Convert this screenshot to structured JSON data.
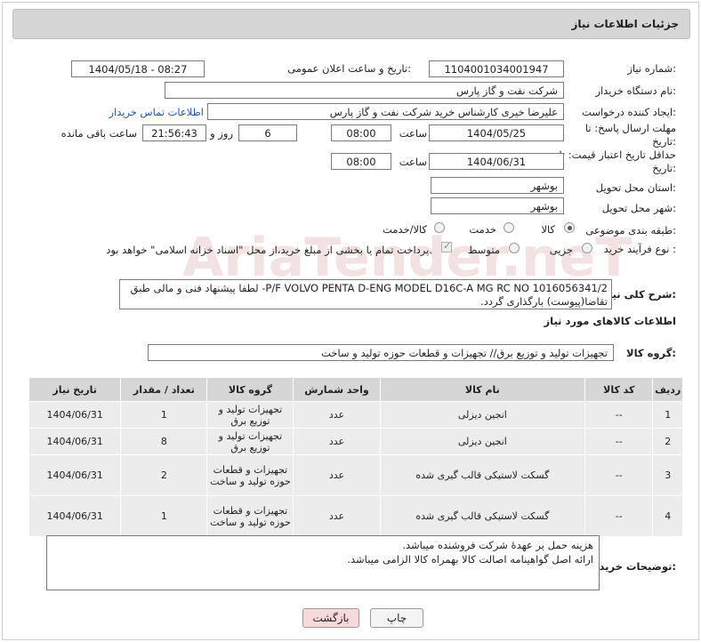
{
  "title": "جزئیات اطلاعات نیاز",
  "need_number": {
    "label": "شماره نیاز:",
    "value": "1104001034001947"
  },
  "announce_datetime": {
    "label": "تاریخ و ساعت اعلان عمومی:",
    "value": "1404/05/18 - 08:27"
  },
  "buyer_org": {
    "label": "نام دستگاه خریدار:",
    "value": "شرکت نفت و گاز پارس"
  },
  "requester": {
    "label": "ایجاد کننده درخواست:",
    "value": "علیرضا  خیری کارشناس خرید  شرکت نفت و گاز پارس",
    "contact_link": "اطلاعات تماس خریدار"
  },
  "reply_deadline": {
    "label": "مهلت ارسال پاسخ: تا تاریخ:",
    "date": "1404/05/25",
    "time_label": "ساعت",
    "time": "08:00",
    "days": "6",
    "days_label": "روز و",
    "remaining": "21:56:43",
    "remaining_label": "ساعت باقی مانده"
  },
  "price_validity": {
    "label": "حداقل تاریخ اعتبار قیمت: تا تاریخ:",
    "date": "1404/06/31",
    "time_label": "ساعت",
    "time": "08:00"
  },
  "delivery_province": {
    "label": "استان محل تحویل:",
    "value": "بوشهر"
  },
  "delivery_city": {
    "label": "شهر محل تحویل:",
    "value": "بوشهر"
  },
  "category": {
    "label": "طبقه بندی موضوعی:",
    "options": [
      "کالا",
      "خدمت",
      "کالا/خدمت"
    ],
    "selected": "کالا"
  },
  "process": {
    "label": "نوع فرآیند خرید :",
    "options": [
      "جزیی",
      "متوسط"
    ],
    "note": "پرداخت تمام یا بخشی از مبلغ خرید،از محل \"اسناد خزانه اسلامی\" خواهد بود."
  },
  "description": {
    "label": "شرح کلی نیاز:",
    "line1": "P/F VOLVO PENTA D-ENG  MODEL D16C-A MG RC NO 1016056341/2- لطفا پیشنهاد فنی و مالی طبق",
    "line2": "تقاضا(پیوست) بارگذاری گردد."
  },
  "goods_info_title": "اطلاعات کالاهای مورد نیاز",
  "goods_group": {
    "label": "گروه کالا:",
    "value": "تجهیزات تولید و توزیع برق// تجهیزات و قطعات حوزه تولید و ساخت"
  },
  "table": {
    "headers": [
      "ردیف",
      "کد کالا",
      "نام کالا",
      "واحد شمارش",
      "گروه کالا",
      "تعداد / مقدار",
      "تاریخ نیاز"
    ],
    "rows": [
      [
        "1",
        "--",
        "انجین دیزلی",
        "عدد",
        "تجهیزات تولید و توزیع برق",
        "1",
        "1404/06/31"
      ],
      [
        "2",
        "--",
        "انجین دیزلی",
        "عدد",
        "تجهیزات تولید و توزیع برق",
        "8",
        "1404/06/31"
      ],
      [
        "3",
        "--",
        "گسکت لاستیکی قالب گیری شده",
        "عدد",
        "تجهیزات و قطعات حوزه تولید و ساخت",
        "2",
        "1404/06/31"
      ],
      [
        "4",
        "--",
        "گسکت لاستیکی قالب گیری شده",
        "عدد",
        "تجهیزات و قطعات حوزه تولید و ساخت",
        "1",
        "1404/06/31"
      ]
    ]
  },
  "buyer_notes": {
    "label": "توضیحات خریدار:",
    "line1": "هزینه حمل بر عهدهٔ شرکت فروشنده میباشد.",
    "line2": "ارائه اصل گواهینامه اصالت کالا بهمراه کالا الزامی میباشد."
  },
  "buttons": {
    "print": "چاپ",
    "back": "بازگشت"
  },
  "watermark": "AriaTender.neT",
  "colors": {
    "header_bg": "#d6d6d6",
    "link": "#1b58b8",
    "back_btn": "#f7d9d9"
  }
}
